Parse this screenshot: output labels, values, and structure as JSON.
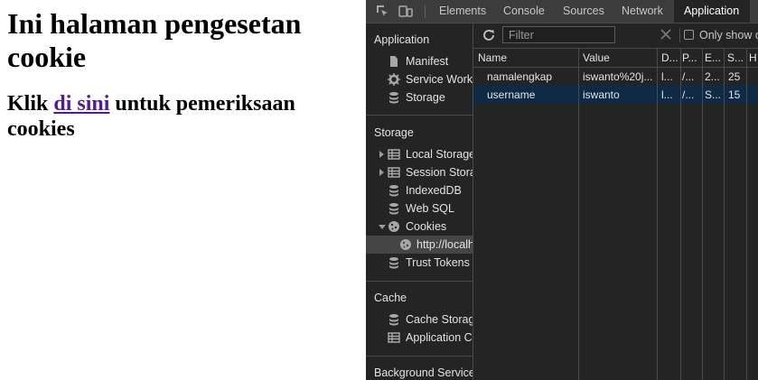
{
  "page": {
    "title": "Ini halaman pengesetan cookie",
    "subtitle_before": "Klik ",
    "link_text": "di sini",
    "subtitle_after": " untuk pemeriksaan cookies"
  },
  "devtools": {
    "tabs": [
      {
        "label": "Elements"
      },
      {
        "label": "Console"
      },
      {
        "label": "Sources"
      },
      {
        "label": "Network"
      },
      {
        "label": "Application"
      }
    ],
    "sidebar": {
      "application_header": "Application",
      "application_items": [
        {
          "label": "Manifest",
          "icon": "document-icon"
        },
        {
          "label": "Service Workers",
          "icon": "gear-icon"
        },
        {
          "label": "Storage",
          "icon": "database-icon"
        }
      ],
      "storage_header": "Storage",
      "storage_items": [
        {
          "label": "Local Storage",
          "icon": "grid-icon"
        },
        {
          "label": "Session Storage",
          "icon": "grid-icon"
        },
        {
          "label": "IndexedDB",
          "icon": "database-icon"
        },
        {
          "label": "Web SQL",
          "icon": "database-icon"
        },
        {
          "label": "Cookies",
          "icon": "cookie-icon"
        },
        {
          "label": "http://localhost",
          "icon": "cookie-icon"
        },
        {
          "label": "Trust Tokens",
          "icon": "database-icon"
        }
      ],
      "cache_header": "Cache",
      "cache_items": [
        {
          "label": "Cache Storage",
          "icon": "database-icon"
        },
        {
          "label": "Application Cache",
          "icon": "grid-icon"
        }
      ],
      "background_header": "Background Services"
    },
    "filter": {
      "placeholder": "Filter",
      "only_show_label": "Only show cookies with an issue"
    },
    "table": {
      "columns": [
        "Name",
        "Value",
        "D...",
        "P...",
        "E...",
        "S...",
        "H"
      ],
      "rows": [
        {
          "name": "namalengkap",
          "value": "iswanto%20j...",
          "domain": "l...",
          "path": "/...",
          "expires": "2...",
          "size": "25"
        },
        {
          "name": "username",
          "value": "iswanto",
          "domain": "l...",
          "path": "/...",
          "expires": "S...",
          "size": "15"
        }
      ]
    },
    "colors": {
      "panel_bg": "#242424",
      "toolbar_bg": "#3c3c3c",
      "selected_row": "#0e2a44",
      "link": "#551a8b"
    }
  }
}
